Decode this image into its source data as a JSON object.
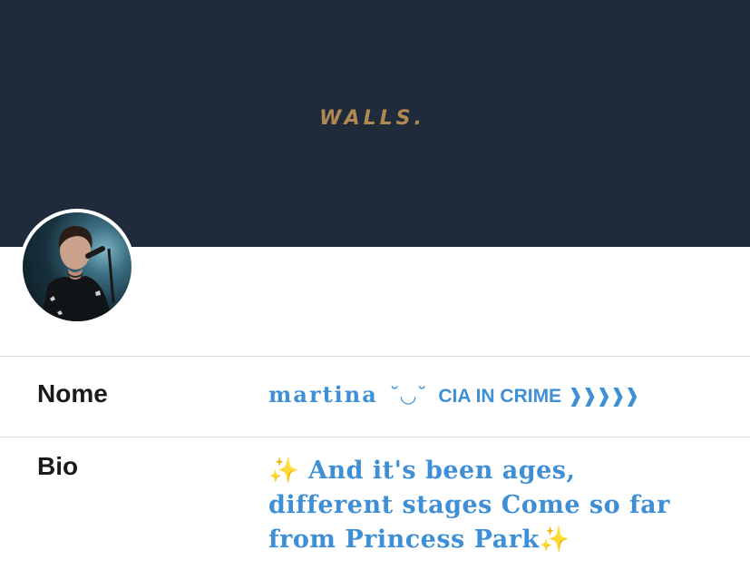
{
  "header": {
    "banner_title": "WALLS.",
    "background_color": "#1f2a3a",
    "title_color": "#b08952"
  },
  "profile": {
    "avatar_description_icon": "profile-photo"
  },
  "fields": {
    "name_label": "Nome",
    "name_value_script": "martina",
    "name_value_face": "˘◡˘",
    "name_value_crime": "CIA IN CRIME",
    "name_value_arrows": "❱❱❱❱❱",
    "bio_label": "Bio",
    "bio_sparkle_start": "✨",
    "bio_text": " And it's been ages, different stages Come so far from Princess Park",
    "bio_sparkle_end": "✨"
  },
  "colors": {
    "accent_text": "#3f8fd6",
    "divider": "#d9d9d9"
  }
}
